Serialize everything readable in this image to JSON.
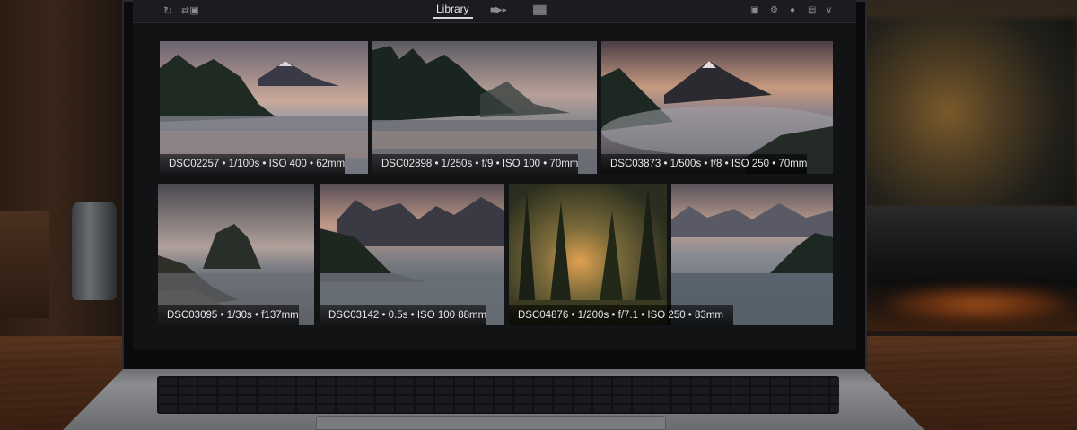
{
  "app": {
    "active_tab": "Library",
    "toolbar_left_icons": [
      "refresh-icon",
      "sync-icon"
    ],
    "toolbar_center_icons": [
      "slideshow-icon",
      "grid-view-icon"
    ],
    "toolbar_right_icons": [
      "panel-icon",
      "settings-icon",
      "circle-icon",
      "save-icon",
      "chevron-down-icon"
    ]
  },
  "photos": [
    {
      "caption": "DSC02257 • 1/100s • ISO 400 • 62mm"
    },
    {
      "caption": "DSC02898 • 1/250s • f/9 • ISO 100 • 70mm"
    },
    {
      "caption": "DSC03873 • 1/500s • f/8 • ISO 250 • 70mm"
    },
    {
      "caption": "DSC03095 • 1/30s • f137mm"
    },
    {
      "caption": "DSC03142 • 0.5s • ISO 100 88mm"
    },
    {
      "caption": "DSC04876 • 1/200s • f/7.1 • ISO 250 • 83mm"
    },
    {
      "caption": ""
    }
  ]
}
